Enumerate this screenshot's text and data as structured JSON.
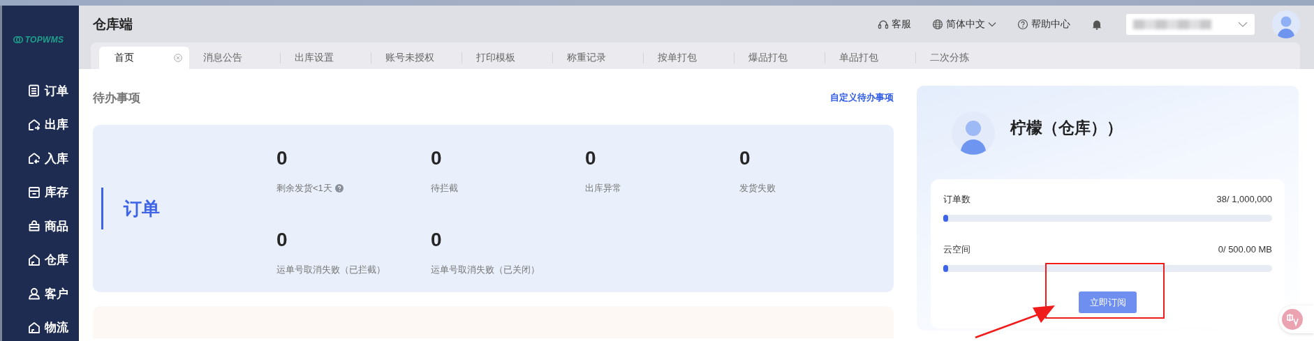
{
  "sidebar": {
    "logo": "TOPWMS",
    "items": [
      {
        "label": "订单"
      },
      {
        "label": "出库"
      },
      {
        "label": "入库"
      },
      {
        "label": "库存"
      },
      {
        "label": "商品"
      },
      {
        "label": "仓库"
      },
      {
        "label": "客户"
      },
      {
        "label": "物流"
      }
    ]
  },
  "header": {
    "title": "仓库端",
    "actions": [
      {
        "kind": "service",
        "label": "客服"
      },
      {
        "kind": "language",
        "label": "简体中文"
      },
      {
        "kind": "help",
        "label": "帮助中心"
      },
      {
        "kind": "bell"
      }
    ],
    "tabs": [
      {
        "label": "首页",
        "selected": true
      },
      {
        "label": "消息公告",
        "selected": false
      },
      {
        "label": "出库设置",
        "selected": false
      },
      {
        "label": "账号未授权",
        "selected": false
      },
      {
        "label": "打印模板",
        "selected": false
      },
      {
        "label": "称重记录",
        "selected": false
      },
      {
        "label": "按单打包",
        "selected": false
      },
      {
        "label": "爆品打包",
        "selected": false
      },
      {
        "label": "单品打包",
        "selected": false
      },
      {
        "label": "二次分拣",
        "selected": false
      }
    ]
  },
  "todo": {
    "title": "待办事项",
    "link": "自定义待办事项",
    "groups": [
      {
        "name": "订单",
        "color": "#e9effb",
        "stats": [
          {
            "value": "0",
            "label": "剩余发货<1天",
            "help": true
          },
          {
            "value": "0",
            "label": "待拦截",
            "help": false
          },
          {
            "value": "0",
            "label": "出库异常",
            "help": false
          },
          {
            "value": "0",
            "label": "发货失败",
            "help": false
          },
          {
            "value": "0",
            "label": "运单号取消失败（已拦截）",
            "help": false
          },
          {
            "value": "0",
            "label": "运单号取消失败（已关闭）",
            "help": false
          }
        ]
      },
      {
        "color": "#fdf8f4"
      }
    ]
  },
  "profile": {
    "name": "柠檬（仓库））",
    "usage": [
      {
        "label": "订单数",
        "reading": "38/ 1,000,000",
        "level": 0.015
      },
      {
        "label": "云空间",
        "reading": "0/ 500.00 MB",
        "level": 0.015
      }
    ],
    "button": "立即订阅",
    "annotation": {
      "kind": "box-arrow"
    }
  }
}
